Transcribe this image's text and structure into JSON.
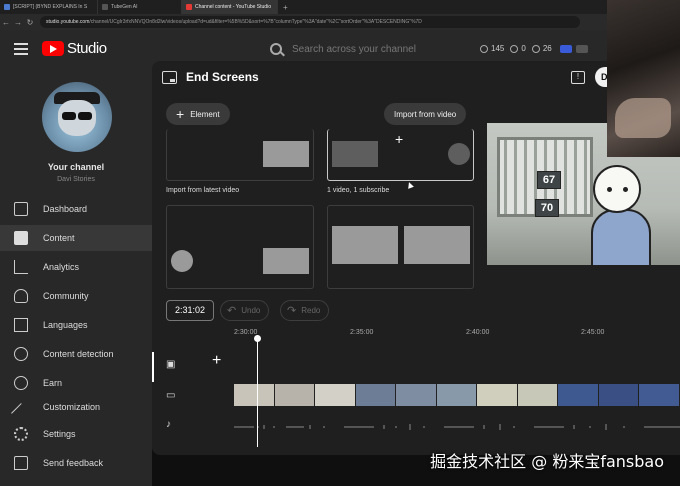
{
  "browser": {
    "tabs": [
      {
        "label": "[SCRIPT] (BYND EXPLAINS In S",
        "color": "#4a7bd0",
        "active": false
      },
      {
        "label": "TubeGen AI",
        "color": "#2b2b2b",
        "active": false
      },
      {
        "label": "Channel content - YouTube Studio",
        "color": "#e53935",
        "active": true
      }
    ],
    "new_tab": "+",
    "url_host": "studio.youtube.com",
    "url_path": "/channel/UCgIr3rfxNNVQOn8d2lw/videos/upload?d=ud&filter=%5B%5D&sort=%7B\"columnType\"%3A\"date\"%2C\"sortOrder\"%3A\"DESCENDING\"%7D"
  },
  "header": {
    "logo_text": "Studio",
    "search_placeholder": "Search across your channel",
    "stat_1": "145",
    "stat_2": "0",
    "stat_3": "26"
  },
  "sidebar": {
    "channel_title": "Your channel",
    "channel_name": "Davi Stories",
    "items": [
      {
        "label": "Dashboard",
        "icon": "dashboard-icon"
      },
      {
        "label": "Content",
        "icon": "content-icon",
        "active": true
      },
      {
        "label": "Analytics",
        "icon": "analytics-icon"
      },
      {
        "label": "Community",
        "icon": "community-icon"
      },
      {
        "label": "Languages",
        "icon": "languages-icon"
      },
      {
        "label": "Content detection",
        "icon": "content-detection-icon"
      },
      {
        "label": "Earn",
        "icon": "earn-icon"
      },
      {
        "label": "Customization",
        "icon": "customization-icon"
      }
    ],
    "bottom_items": [
      {
        "label": "Settings",
        "icon": "settings-icon"
      },
      {
        "label": "Send feedback",
        "icon": "feedback-icon"
      }
    ]
  },
  "editor": {
    "title": "End Screens",
    "save_label": "D",
    "element_button": "Element",
    "import_button": "Import from video",
    "templates": [
      {
        "caption": "Import from latest video"
      },
      {
        "caption": "1 video, 1 subscribe"
      },
      {
        "caption": ""
      },
      {
        "caption": ""
      }
    ],
    "preview_numbers": [
      "67",
      "70"
    ],
    "timecode": "2:31:02",
    "undo_label": "Undo",
    "redo_label": "Redo",
    "ruler_ticks": [
      "2:30:00",
      "2:35:00",
      "2:40:00",
      "2:45:00"
    ],
    "add_element": "+"
  },
  "watermark": "掘金技术社区 @ 粉来宝fansbao",
  "colors": {
    "brand_red": "#ff0000",
    "background": "#0f0f0f",
    "panel": "#1f1f1f",
    "sidebar": "#282828"
  }
}
